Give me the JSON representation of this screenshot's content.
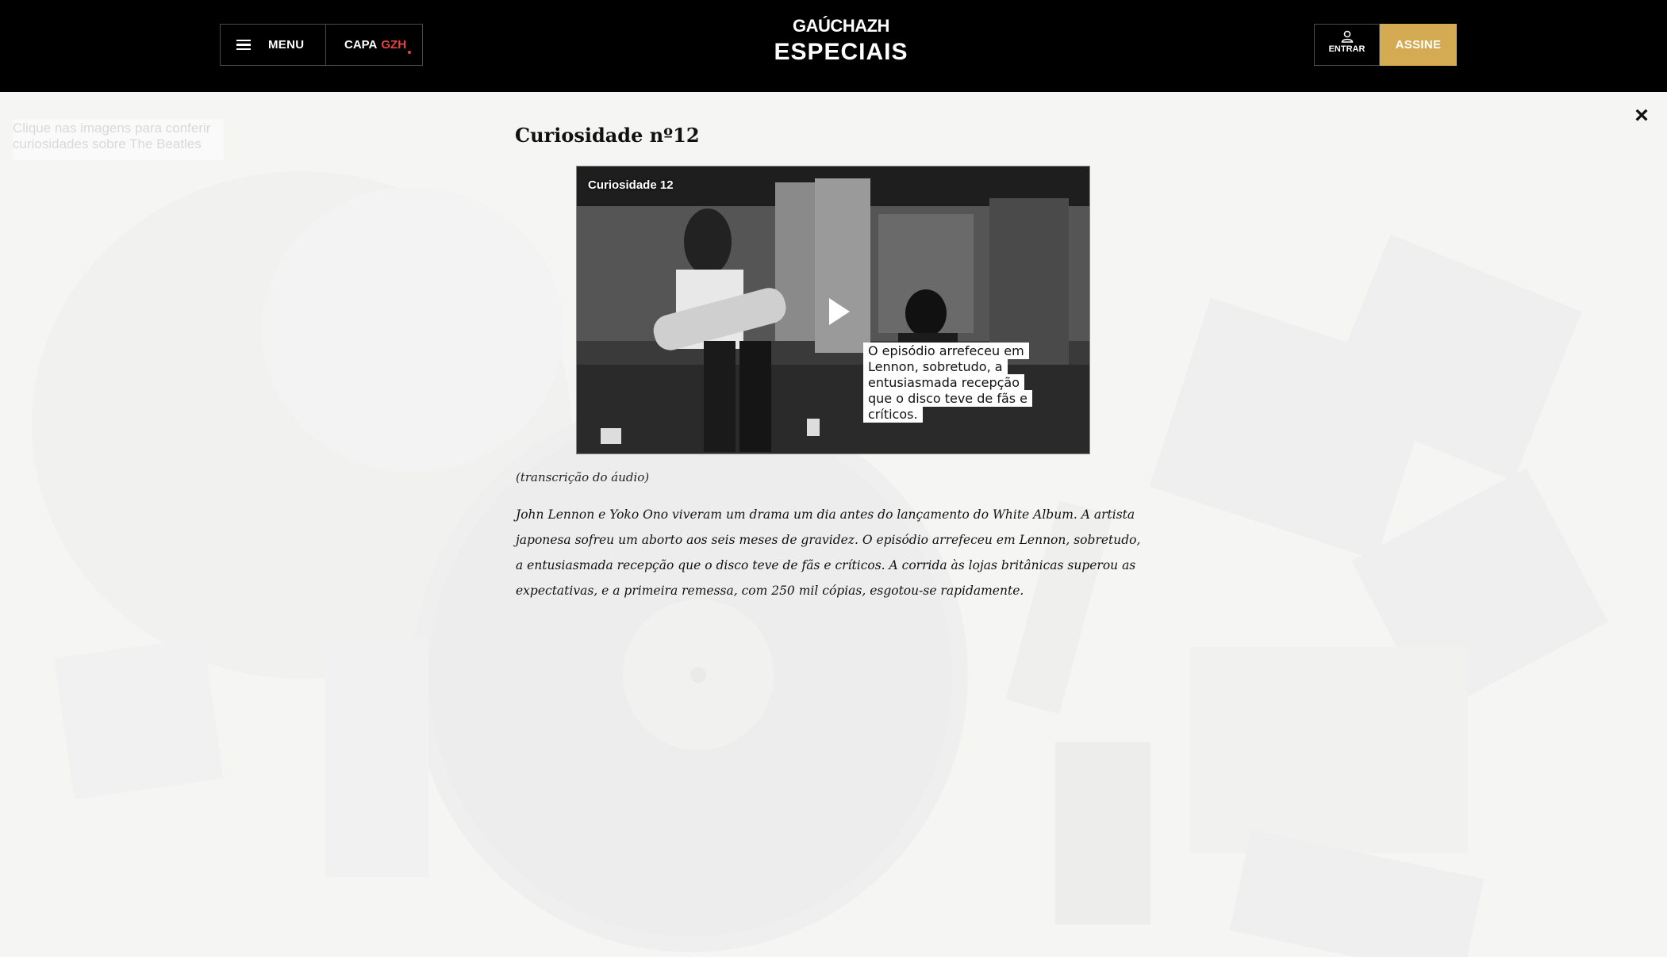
{
  "background": {
    "hint_text": "Clique nas imagens para conferir curiosidades sobre The Beatles"
  },
  "header": {
    "menu_label": "MENU",
    "capa_label": "CAPA",
    "capa_brand": "GZH",
    "logo_top": "GAÚCHAZH",
    "logo_bottom": "ESPECIAIS",
    "login_label": "ENTRAR",
    "subscribe_label": "ASSINE",
    "accent_color": "#d4aa52",
    "gzh_color": "#e6443a"
  },
  "modal": {
    "close_symbol": "×",
    "title": "Curiosidade nº12",
    "video": {
      "label": "Curiosidade 12",
      "caption": "O episódio arrefeceu em Lennon, sobretudo, a entusiasmada recepção que o disco teve de fãs e críticos."
    },
    "transcription_note": "(transcrição do áudio)",
    "body": "John Lennon e Yoko Ono viveram um drama um dia antes do lançamento do White Album. A artista japonesa sofreu um aborto aos seis meses de gravidez. O episódio arrefeceu em Lennon, sobretudo, a entusiasmada recepção que o disco teve de fãs e críticos. A corrida às lojas britânicas superou as expectativas, e a primeira remessa, com 250 mil cópias, esgotou-se rapidamente."
  }
}
